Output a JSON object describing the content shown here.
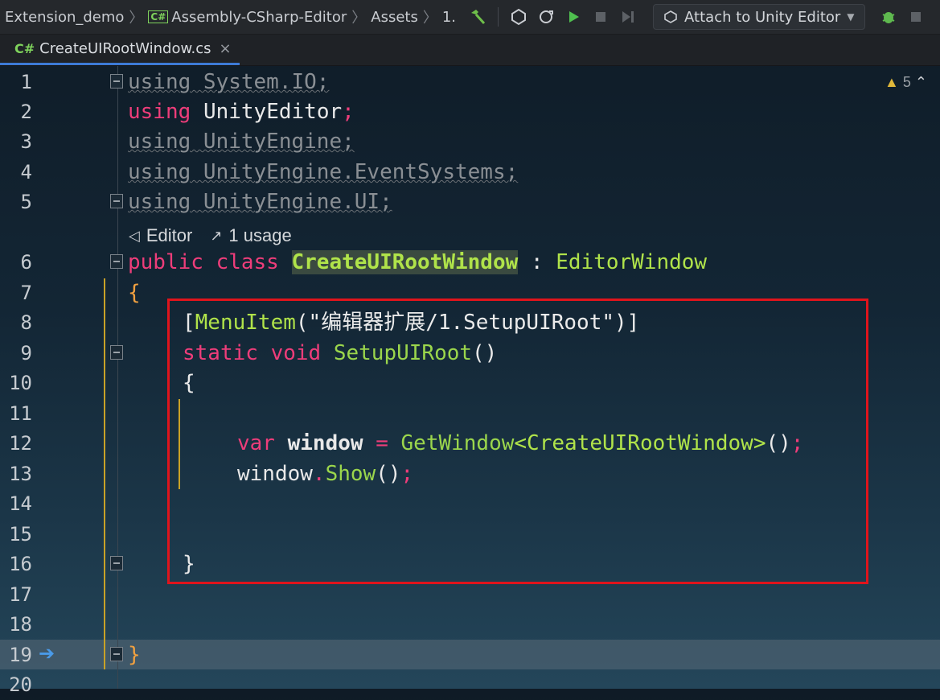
{
  "nav": {
    "crumbs": [
      "Extension_demo",
      "Assembly-CSharp-Editor",
      "Assets",
      "1."
    ],
    "cs_badge": "C#",
    "attach_label": "Attach to Unity Editor"
  },
  "tab": {
    "badge": "C#",
    "label": "CreateUIRootWindow.cs",
    "close": "×"
  },
  "warnings": {
    "count": "5"
  },
  "hint": {
    "editor_label": "Editor",
    "usage_label": "1 usage"
  },
  "lines": {
    "l1": "using System.IO;",
    "l3": "using UnityEngine;",
    "l4": "using UnityEngine.EventSystems;",
    "l5": "using UnityEngine.UI;",
    "l2_kw": "using",
    "l2_ns": "UnityEditor",
    "l2_end": ";",
    "l6_kw": "public class",
    "l6_name": "CreateUIRootWindow",
    "l6_colon": " : ",
    "l6_base": "EditorWindow",
    "l7": "{",
    "l8_open": "[",
    "l8_attr": "MenuItem",
    "l8_str": "(\"编辑器扩展/1.SetupUIRoot\")]",
    "l9_kw": "static void",
    "l9_name": "SetupUIRoot",
    "l9_paren": "()",
    "l10": "{",
    "l12_kw": "var",
    "l12_var": "window",
    "l12_eq": " = ",
    "l12_m": "GetWindow",
    "l12_gen": "<CreateUIRootWindow>",
    "l12_paren": "()",
    "l12_semi": ";",
    "l13_var": "window",
    "l13_dot": ".",
    "l13_m": "Show",
    "l13_paren": "()",
    "l13_semi": ";",
    "l16": "}",
    "l19": "}"
  },
  "line_numbers": [
    "1",
    "2",
    "3",
    "4",
    "5",
    "6",
    "7",
    "8",
    "9",
    "10",
    "11",
    "12",
    "13",
    "14",
    "15",
    "16",
    "17",
    "18",
    "19",
    "20"
  ]
}
